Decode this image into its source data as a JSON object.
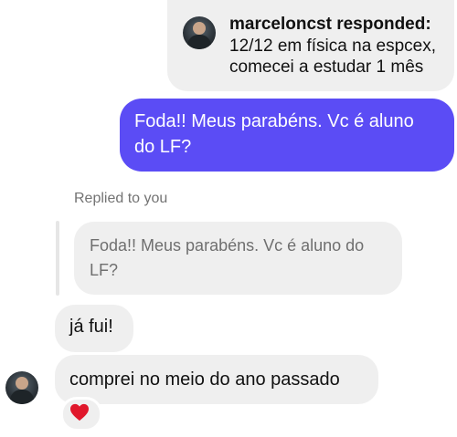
{
  "story_reply": {
    "author_label": "marceloncst responded:",
    "lines": [
      "12/12 em física na espcex,",
      "comecei a estudar 1 mês"
    ]
  },
  "outgoing_message": {
    "lines": [
      "Foda!! Meus parabéns. Vc é aluno",
      "do LF?"
    ]
  },
  "reply_context": {
    "label": "Replied to you",
    "quoted_lines": [
      "Foda!! Meus parabéns. Vc é aluno do",
      "LF?"
    ]
  },
  "incoming_messages": [
    {
      "text": "já fui!"
    },
    {
      "text": "comprei no meio do ano passado"
    }
  ],
  "reaction": {
    "emoji_name": "red-heart-icon",
    "color": "#e0172b"
  },
  "colors": {
    "outgoing_bubble": "#5b4cf5",
    "incoming_bubble": "#efefef",
    "secondary_text": "#737373"
  }
}
